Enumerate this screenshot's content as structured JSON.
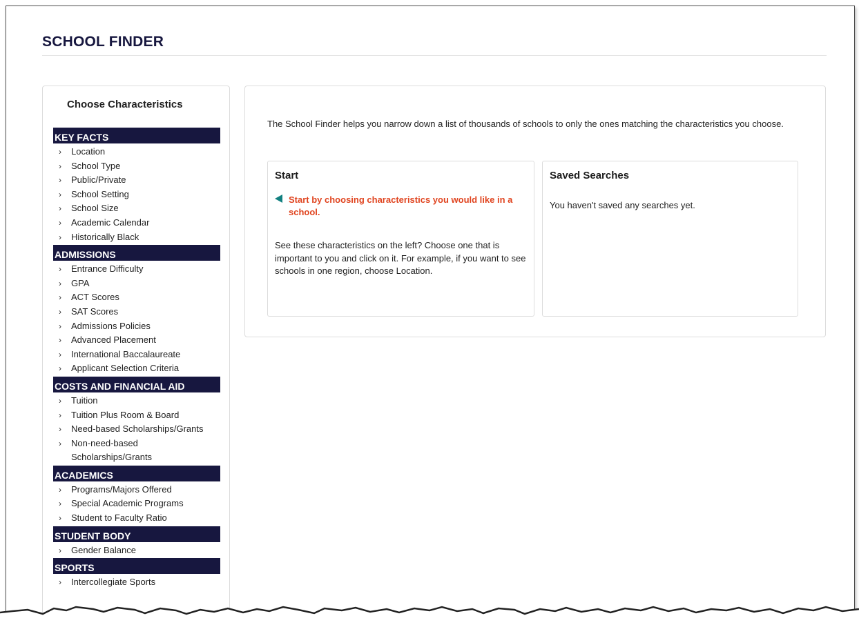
{
  "page": {
    "title": "SCHOOL FINDER"
  },
  "sidebar": {
    "heading": "Choose Characteristics",
    "categories": [
      {
        "label": "KEY FACTS",
        "items": [
          "Location",
          "School Type",
          "Public/Private",
          "School Setting",
          "School Size",
          "Academic Calendar",
          "Historically Black"
        ]
      },
      {
        "label": "ADMISSIONS",
        "items": [
          "Entrance Difficulty",
          "GPA",
          "ACT Scores",
          "SAT Scores",
          "Admissions Policies",
          "Advanced Placement",
          "International Baccalaureate",
          "Applicant Selection Criteria"
        ]
      },
      {
        "label": "COSTS AND FINANCIAL AID",
        "items": [
          "Tuition",
          "Tuition Plus Room & Board",
          "Need-based Scholarships/Grants",
          "Non-need-based Scholarships/Grants"
        ]
      },
      {
        "label": "ACADEMICS",
        "items": [
          "Programs/Majors Offered",
          "Special Academic Programs",
          "Student to Faculty Ratio"
        ]
      },
      {
        "label": "STUDENT BODY",
        "items": [
          "Gender Balance"
        ]
      },
      {
        "label": "SPORTS",
        "items": [
          "Intercollegiate Sports"
        ]
      }
    ]
  },
  "main": {
    "intro": "The School Finder helps you narrow down a list of thousands of schools to only the ones matching the characteristics you choose.",
    "start_card": {
      "title": "Start",
      "callout": "Start by choosing characteristics you would like in a school.",
      "body": "See these characteristics on the left? Choose one that is important to you and click on it. For example, if you want to see schools in one region, choose Location."
    },
    "saved_card": {
      "title": "Saved Searches",
      "body": "You haven't saved any searches yet."
    }
  },
  "icons": {
    "item_chevron": "chevron-right-icon",
    "callout_arrow": "arrow-left-icon"
  },
  "colors": {
    "header_navy": "#17173f",
    "callout_orange": "#e0441f",
    "arrow_teal": "#128080"
  }
}
